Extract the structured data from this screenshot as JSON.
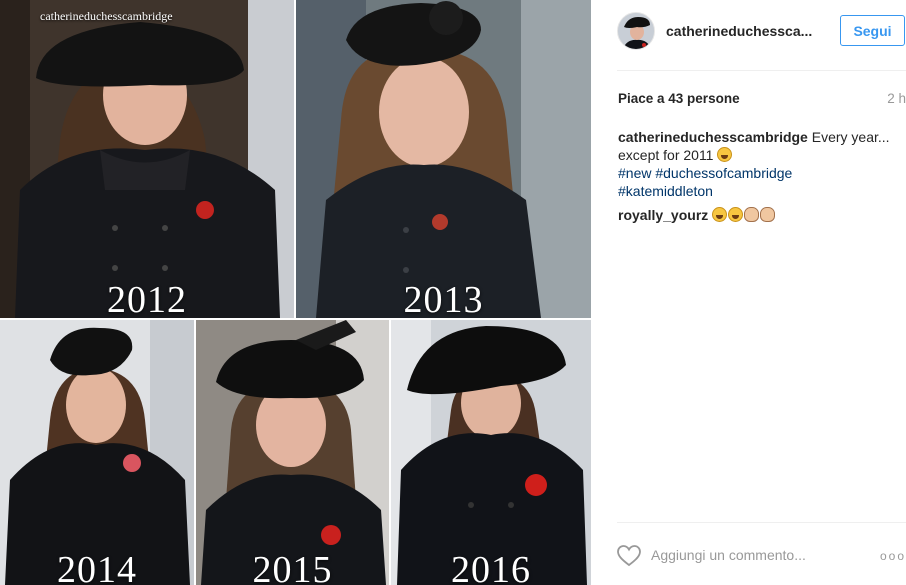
{
  "photos": {
    "watermark": "catherineduchesscambridge",
    "years": [
      "2012",
      "2013",
      "2014",
      "2015",
      "2016"
    ]
  },
  "post": {
    "username": "catherineduchessca...",
    "follow_label": "Segui",
    "likes": "Piace a 43 persone",
    "time": "2 h",
    "caption_user": "catherineduchesscambridge",
    "caption_text": " Every year... except for 2011",
    "hashtags": [
      "#new #duchessofcambridge",
      "#katemiddleton"
    ],
    "comment_user": "royally_yourz",
    "comment_emojis": [
      "laugh-emoji",
      "laugh-emoji",
      "clap-emoji",
      "clap-emoji"
    ],
    "comment_placeholder": "Aggiungi un commento...",
    "more_label": "ooo"
  },
  "colors": {
    "accent": "#3897f0",
    "hashtag": "#003569",
    "muted": "#999999"
  }
}
